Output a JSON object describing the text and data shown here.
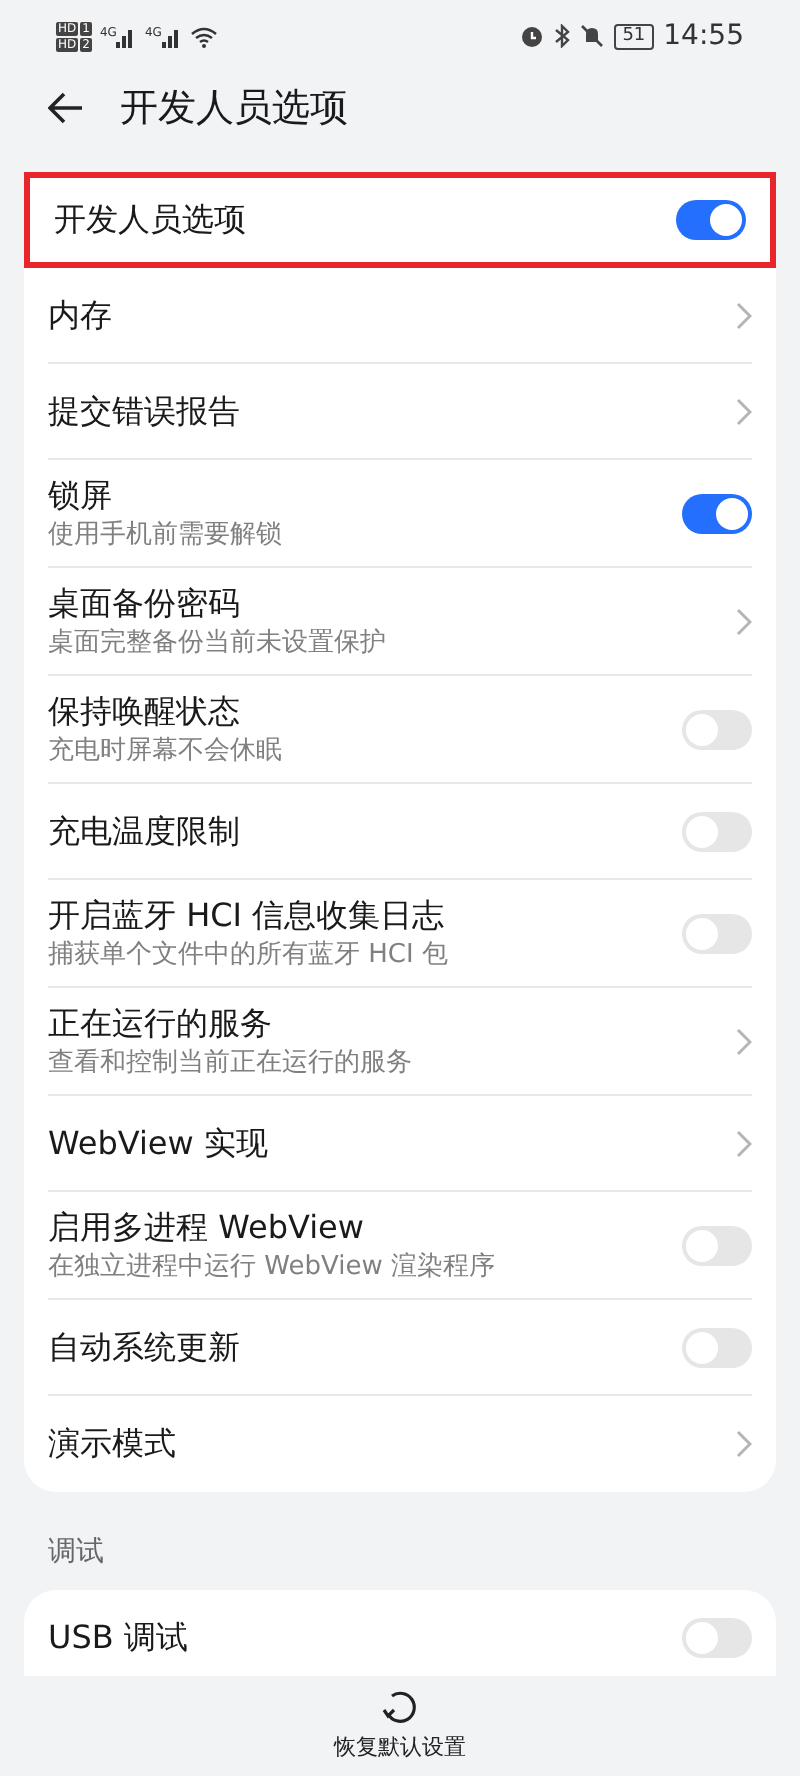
{
  "status_bar": {
    "sims": [
      {
        "badge": "HD",
        "slot": "1"
      },
      {
        "badge": "HD",
        "slot": "2"
      }
    ],
    "networks": [
      "4G",
      "4G"
    ],
    "battery": "51",
    "time": "14:55"
  },
  "header": {
    "title": "开发人员选项"
  },
  "items": [
    {
      "title": "开发人员选项",
      "kind": "toggle",
      "on": true,
      "highlighted": true
    },
    {
      "title": "内存",
      "kind": "link"
    },
    {
      "title": "提交错误报告",
      "kind": "link"
    },
    {
      "title": "锁屏",
      "subtitle": "使用手机前需要解锁",
      "kind": "toggle",
      "on": true
    },
    {
      "title": "桌面备份密码",
      "subtitle": "桌面完整备份当前未设置保护",
      "kind": "link"
    },
    {
      "title": "保持唤醒状态",
      "subtitle": "充电时屏幕不会休眠",
      "kind": "toggle",
      "on": false
    },
    {
      "title": "充电温度限制",
      "kind": "toggle",
      "on": false
    },
    {
      "title": "开启蓝牙 HCI 信息收集日志",
      "subtitle": "捕获单个文件中的所有蓝牙 HCI 包",
      "kind": "toggle",
      "on": false
    },
    {
      "title": "正在运行的服务",
      "subtitle": "查看和控制当前正在运行的服务",
      "kind": "link"
    },
    {
      "title": "WebView 实现",
      "kind": "link"
    },
    {
      "title": "启用多进程 WebView",
      "subtitle": "在独立进程中运行 WebView 渲染程序",
      "kind": "toggle",
      "on": false
    },
    {
      "title": "自动系统更新",
      "kind": "toggle",
      "on": false
    },
    {
      "title": "演示模式",
      "kind": "link"
    }
  ],
  "section": {
    "label": "调试",
    "items": [
      {
        "title": "USB 调试",
        "kind": "toggle",
        "on": false
      }
    ]
  },
  "bottom_action": {
    "label": "恢复默认设置"
  }
}
